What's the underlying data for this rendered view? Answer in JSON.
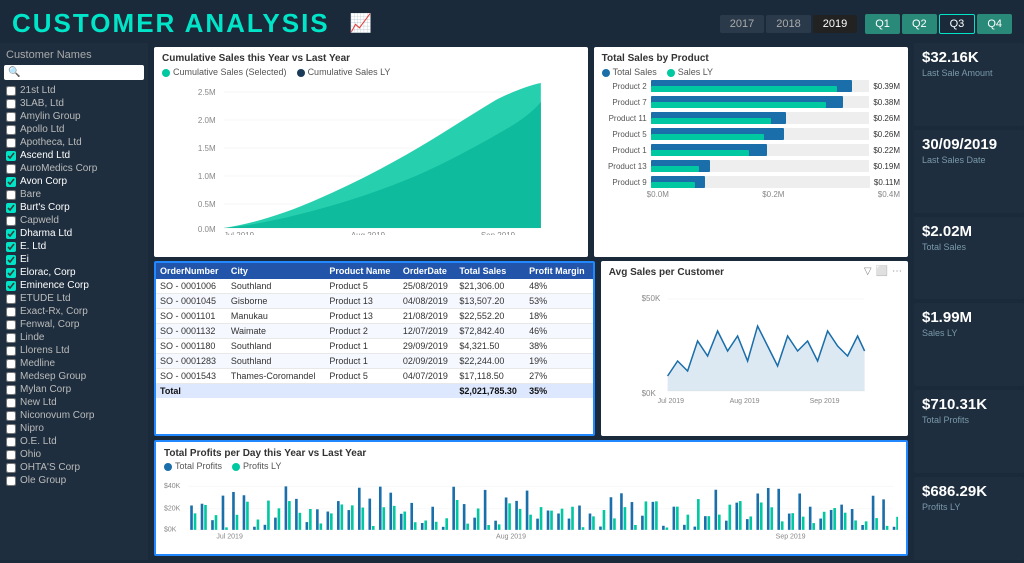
{
  "header": {
    "title": "CUSTOMER ANALYSIS",
    "year_tabs": [
      "2017",
      "2018",
      "2019"
    ],
    "active_year": "2019",
    "quarter_tabs": [
      "Q1",
      "Q2",
      "Q3",
      "Q4"
    ],
    "active_quarter": "Q3"
  },
  "sidebar": {
    "title": "Customer Names",
    "search_placeholder": "",
    "customers": [
      {
        "name": "21st Ltd",
        "checked": false
      },
      {
        "name": "3LAB, Ltd",
        "checked": false
      },
      {
        "name": "Amylin Group",
        "checked": false
      },
      {
        "name": "Apollo Ltd",
        "checked": false
      },
      {
        "name": "Apotheca, Ltd",
        "checked": false
      },
      {
        "name": "Ascend Ltd",
        "checked": true
      },
      {
        "name": "AuroMedics Corp",
        "checked": false
      },
      {
        "name": "Avon Corp",
        "checked": true
      },
      {
        "name": "Bare",
        "checked": false
      },
      {
        "name": "Burt's Corp",
        "checked": true
      },
      {
        "name": "Capweld",
        "checked": false
      },
      {
        "name": "Dharma Ltd",
        "checked": true
      },
      {
        "name": "E. Ltd",
        "checked": true
      },
      {
        "name": "Ei",
        "checked": true
      },
      {
        "name": "Elorac, Corp",
        "checked": true
      },
      {
        "name": "Eminence Corp",
        "checked": true
      },
      {
        "name": "ETUDE Ltd",
        "checked": false
      },
      {
        "name": "Exact-Rx, Corp",
        "checked": false
      },
      {
        "name": "Fenwal, Corp",
        "checked": false
      },
      {
        "name": "Linde",
        "checked": false
      },
      {
        "name": "Llorens Ltd",
        "checked": false
      },
      {
        "name": "Medline",
        "checked": false
      },
      {
        "name": "Medsep Group",
        "checked": false
      },
      {
        "name": "Mylan Corp",
        "checked": false
      },
      {
        "name": "New Ltd",
        "checked": false
      },
      {
        "name": "Niconovum Corp",
        "checked": false
      },
      {
        "name": "Nipro",
        "checked": false
      },
      {
        "name": "O.E. Ltd",
        "checked": false
      },
      {
        "name": "Ohio",
        "checked": false
      },
      {
        "name": "OHTA'S Corp",
        "checked": false
      },
      {
        "name": "Ole Group",
        "checked": false
      }
    ]
  },
  "cumulative_chart": {
    "title": "Cumulative Sales this Year vs Last Year",
    "legend_selected": "Cumulative Sales (Selected)",
    "legend_ly": "Cumulative Sales LY",
    "color_selected": "#00c8a0",
    "color_ly": "#1a3a5a",
    "y_labels": [
      "2.5M",
      "2.0M",
      "1.5M",
      "1.0M",
      "0.5M",
      "0.0M"
    ],
    "x_labels": [
      "Jul 2019",
      "Aug 2019",
      "Sep 2019"
    ]
  },
  "product_chart": {
    "title": "Total Sales by Product",
    "legend_sales": "Total Sales",
    "legend_ly": "Sales LY",
    "color_sales": "#1a6eaa",
    "color_ly": "#00c8a0",
    "products": [
      {
        "name": "Product 2",
        "sales_pct": 92,
        "ly_pct": 85,
        "value": "$0.39M"
      },
      {
        "name": "Product 7",
        "sales_pct": 88,
        "ly_pct": 80,
        "value": "$0.38M"
      },
      {
        "name": "Product 11",
        "sales_pct": 62,
        "ly_pct": 55,
        "value": "$0.26M"
      },
      {
        "name": "Product 5",
        "sales_pct": 61,
        "ly_pct": 52,
        "value": "$0.26M"
      },
      {
        "name": "Product 1",
        "sales_pct": 53,
        "ly_pct": 45,
        "value": "$0.22M"
      },
      {
        "name": "Product 13",
        "sales_pct": 27,
        "ly_pct": 22,
        "value": "$0.19M"
      },
      {
        "name": "Product 9",
        "sales_pct": 25,
        "ly_pct": 20,
        "value": "$0.11M"
      }
    ],
    "x_labels": [
      "$0.0M",
      "$0.2M",
      "$0.4M"
    ]
  },
  "stats": [
    {
      "value": "$32.16K",
      "label": "Last Sale Amount"
    },
    {
      "value": "30/09/2019",
      "label": "Last Sales Date"
    },
    {
      "value": "$2.02M",
      "label": "Total Sales"
    },
    {
      "value": "$1.99M",
      "label": "Sales LY"
    },
    {
      "value": "$710.31K",
      "label": "Total Profits"
    },
    {
      "value": "$686.29K",
      "label": "Profits LY"
    }
  ],
  "table": {
    "columns": [
      "OrderNumber",
      "City",
      "Product Name",
      "OrderDate",
      "Total Sales",
      "Profit Margin"
    ],
    "rows": [
      [
        "SO - 0001006",
        "Southland",
        "Product 5",
        "25/08/2019",
        "$21,306.00",
        "48%"
      ],
      [
        "SO - 0001045",
        "Gisborne",
        "Product 13",
        "04/08/2019",
        "$13,507.20",
        "53%"
      ],
      [
        "SO - 0001101",
        "Manukau",
        "Product 13",
        "21/08/2019",
        "$22,552.20",
        "18%"
      ],
      [
        "SO - 0001132",
        "Waimate",
        "Product 2",
        "12/07/2019",
        "$72,842.40",
        "46%"
      ],
      [
        "SO - 0001180",
        "Southland",
        "Product 1",
        "29/09/2019",
        "$4,321.50",
        "38%"
      ],
      [
        "SO - 0001283",
        "Southland",
        "Product 1",
        "02/09/2019",
        "$22,244.00",
        "19%"
      ],
      [
        "SO - 0001543",
        "Thames-Coromandel",
        "Product 5",
        "04/07/2019",
        "$17,118.50",
        "27%"
      ]
    ],
    "footer": [
      "Total",
      "",
      "",
      "",
      "$2,021,785.30",
      "35%"
    ]
  },
  "avg_sales": {
    "title": "Avg Sales per Customer",
    "y_labels": [
      "$50K",
      "$0K"
    ],
    "x_labels": [
      "Jul 2019",
      "Aug 2019",
      "Sep 2019"
    ]
  },
  "profits_chart": {
    "title": "Total Profits per Day this Year vs Last Year",
    "legend_profits": "Total Profits",
    "legend_ly": "Profits LY",
    "color_profits": "#1a6eaa",
    "color_ly": "#00c8a0",
    "y_labels": [
      "$40K",
      "$20K",
      "$0K"
    ],
    "x_labels": [
      "Jul 2019",
      "Aug 2019",
      "Sep 2019"
    ]
  }
}
